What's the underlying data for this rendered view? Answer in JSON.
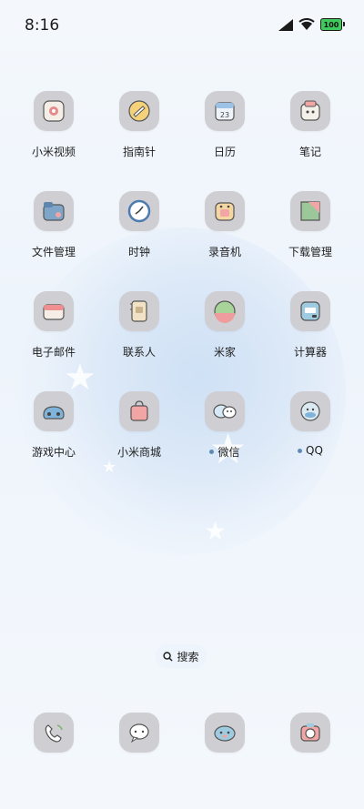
{
  "status_bar": {
    "time": "8:16",
    "battery": "100"
  },
  "apps": [
    {
      "label": "小米视频",
      "icon": "video-icon",
      "dot": false
    },
    {
      "label": "指南针",
      "icon": "compass-icon",
      "dot": false
    },
    {
      "label": "日历",
      "icon": "calendar-icon",
      "dot": false
    },
    {
      "label": "笔记",
      "icon": "notes-icon",
      "dot": false
    },
    {
      "label": "文件管理",
      "icon": "file-manager-icon",
      "dot": false
    },
    {
      "label": "时钟",
      "icon": "clock-icon",
      "dot": false
    },
    {
      "label": "录音机",
      "icon": "recorder-icon",
      "dot": false
    },
    {
      "label": "下载管理",
      "icon": "download-icon",
      "dot": false
    },
    {
      "label": "电子邮件",
      "icon": "email-icon",
      "dot": false
    },
    {
      "label": "联系人",
      "icon": "contacts-icon",
      "dot": false
    },
    {
      "label": "米家",
      "icon": "mijia-icon",
      "dot": false
    },
    {
      "label": "计算器",
      "icon": "calculator-icon",
      "dot": false
    },
    {
      "label": "游戏中心",
      "icon": "game-center-icon",
      "dot": false
    },
    {
      "label": "小米商城",
      "icon": "mi-store-icon",
      "dot": false
    },
    {
      "label": "微信",
      "icon": "wechat-icon",
      "dot": true
    },
    {
      "label": "QQ",
      "icon": "qq-icon",
      "dot": true
    }
  ],
  "search": {
    "label": "搜索"
  },
  "dock": [
    {
      "icon": "phone-icon"
    },
    {
      "icon": "messages-icon"
    },
    {
      "icon": "browser-icon"
    },
    {
      "icon": "camera-icon"
    }
  ],
  "colors": {
    "tile": "#cfcfd3",
    "dot": "#5e8bb6",
    "battery": "#3ecb5b"
  }
}
